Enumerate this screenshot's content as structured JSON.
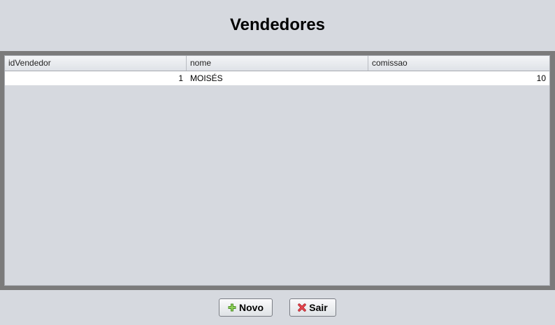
{
  "window": {
    "title": "Vendedores"
  },
  "table": {
    "columns": [
      "idVendedor",
      "nome",
      "comissao"
    ],
    "rows": [
      {
        "idVendedor": "1",
        "nome": "MOISÉS",
        "comissao": "10"
      }
    ]
  },
  "buttons": {
    "novo": {
      "label": "Novo",
      "icon": "plus-icon",
      "icon_color": "#6bb33a"
    },
    "sair": {
      "label": "Sair",
      "icon": "x-icon",
      "icon_color": "#d9343c"
    }
  }
}
